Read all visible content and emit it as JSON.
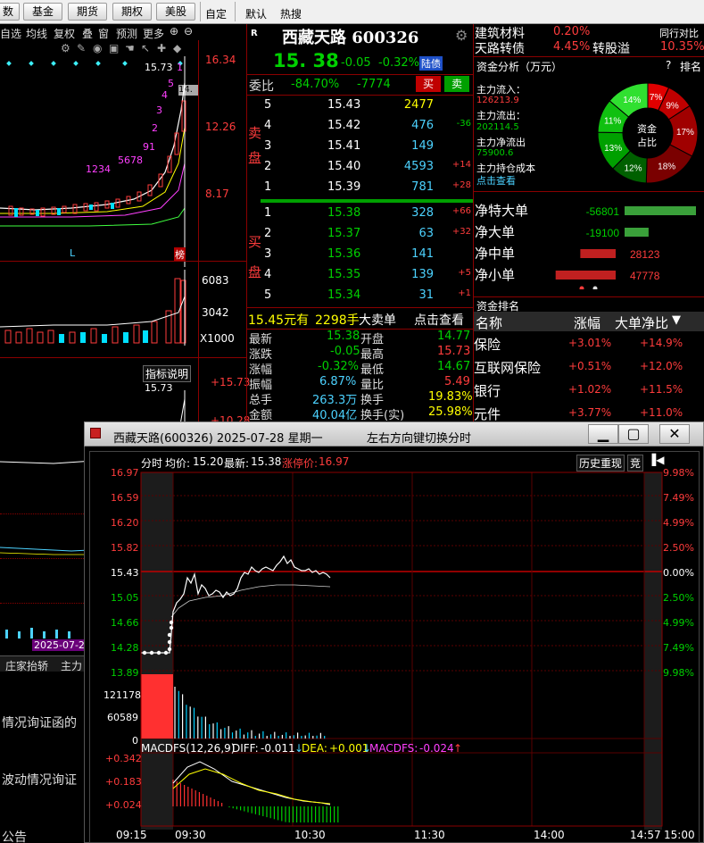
{
  "toolbar": {
    "buttons": [
      "数",
      "基金",
      "期货",
      "期权",
      "美股"
    ],
    "labels": [
      "自定",
      "默认",
      "热搜"
    ]
  },
  "left_panel": {
    "tabs": [
      "自选",
      "均线",
      "复权",
      "叠",
      "窗",
      "预测",
      "更多"
    ],
    "kline_prices": [
      "16.34",
      "12.26",
      "8.17"
    ],
    "kline_last": "15.73",
    "kline_cut": "14.",
    "seq_labels": [
      "1234",
      "5678",
      "91",
      "2",
      "3",
      "4",
      "5",
      "1"
    ],
    "l_marker": "L",
    "tag_bang": "榜",
    "vol_labels": [
      "6083",
      "3042",
      "X1000"
    ],
    "ind_title": "指标说明",
    "ind_last": "15.73",
    "ind_axis": [
      "+15.73",
      "+10.28"
    ],
    "date_tag": "2025-07-2",
    "bottom_tabs": [
      "庄家抬轿",
      "主力"
    ],
    "news": [
      "情况询证函的",
      "波动情况询证",
      "公告"
    ]
  },
  "stock": {
    "badge": "R",
    "name": "西藏天路 600326",
    "price": "15. 38",
    "change": "-0.05",
    "change_pct": "-0.32%",
    "tag": "陆债",
    "weibi_label": "委比",
    "weibi_pct": "-84.70%",
    "weibi_diff": "-7774",
    "buy_btn": "买",
    "sell_btn": "卖",
    "sell_label": [
      "卖",
      "盘"
    ],
    "buy_label": [
      "买",
      "盘"
    ],
    "asks": [
      {
        "lvl": "5",
        "price": "15.43",
        "vol": "2477",
        "chg": ""
      },
      {
        "lvl": "4",
        "price": "15.42",
        "vol": "476",
        "chg": "-36"
      },
      {
        "lvl": "3",
        "price": "15.41",
        "vol": "149",
        "chg": ""
      },
      {
        "lvl": "2",
        "price": "15.40",
        "vol": "4593",
        "chg": "+14"
      },
      {
        "lvl": "1",
        "price": "15.39",
        "vol": "781",
        "chg": "+28"
      }
    ],
    "bids": [
      {
        "lvl": "1",
        "price": "15.38",
        "vol": "328",
        "chg": "+66"
      },
      {
        "lvl": "2",
        "price": "15.37",
        "vol": "63",
        "chg": "+32"
      },
      {
        "lvl": "3",
        "price": "15.36",
        "vol": "141",
        "chg": ""
      },
      {
        "lvl": "4",
        "price": "15.35",
        "vol": "139",
        "chg": "+5"
      },
      {
        "lvl": "5",
        "price": "15.34",
        "vol": "31",
        "chg": "+1"
      }
    ],
    "big_order": {
      "price": "15.45元有",
      "vol": "2298手",
      "label": "大卖单",
      "link": "点击查看"
    },
    "stats": [
      {
        "l": "最新",
        "v": "15.38",
        "l2": "开盘",
        "v2": "14.77"
      },
      {
        "l": "涨跌",
        "v": "-0.05",
        "l2": "最高",
        "v2": "15.73"
      },
      {
        "l": "涨幅",
        "v": "-0.32%",
        "l2": "最低",
        "v2": "14.67"
      },
      {
        "l": "振幅",
        "v": "6.87%",
        "l2": "量比",
        "v2": "5.49"
      },
      {
        "l": "总手",
        "v": "263.3万",
        "l2": "换手",
        "v2": "19.83%"
      },
      {
        "l": "金额",
        "v": "40.04亿",
        "l2": "换手(实)",
        "v2": "25.98%"
      }
    ]
  },
  "right_panel": {
    "sector1": {
      "name": "建筑材料",
      "pct": "0.20%",
      "extra": "同行对比"
    },
    "sector2": {
      "name": "天路转债",
      "pct": "4.45%",
      "label": "转股溢",
      "val": "10.35%"
    },
    "fund_title": "资金分析（万元）",
    "fund_help": "?",
    "fund_rank": "排名",
    "flow_in_label": "主力流入：",
    "flow_in": "126213.9",
    "flow_out_label": "主力流出：",
    "flow_out": "202114.5",
    "net_label": "主力净流出",
    "net": "75900.6",
    "cost_label": "主力持仓成本",
    "cost_link": "点击查看",
    "donut_center": [
      "资金",
      "占比"
    ],
    "donut": [
      {
        "label": "7%",
        "value": 7,
        "color": "#e00000"
      },
      {
        "label": "9%",
        "value": 9,
        "color": "#c00000"
      },
      {
        "label": "17%",
        "value": 17,
        "color": "#a00000"
      },
      {
        "label": "18%",
        "value": 18,
        "color": "#7a0000"
      },
      {
        "label": "12%",
        "value": 12,
        "color": "#006000"
      },
      {
        "label": "13%",
        "value": 13,
        "color": "#00a000"
      },
      {
        "label": "11%",
        "value": 11,
        "color": "#10c010"
      },
      {
        "label": "14%",
        "value": 14,
        "color": "#30e030"
      }
    ],
    "net_flows": [
      {
        "label": "净特大单",
        "value": -56801,
        "text": "-56801"
      },
      {
        "label": "净大单",
        "value": -19100,
        "text": "-19100"
      },
      {
        "label": "净中单",
        "value": 28123,
        "text": "28123"
      },
      {
        "label": "净小单",
        "value": 47778,
        "text": "47778"
      }
    ],
    "rank_title": "资金排名",
    "rank_headers": [
      "名称",
      "涨幅",
      "大单净比"
    ],
    "rank_rows": [
      {
        "name": "保险",
        "pct": "+3.01%",
        "net": "+14.9%"
      },
      {
        "name": "互联网保险",
        "pct": "+0.51%",
        "net": "+12.0%"
      },
      {
        "name": "银行",
        "pct": "+1.02%",
        "net": "+11.5%"
      },
      {
        "name": "元件",
        "pct": "+3.77%",
        "net": "+11.0%"
      }
    ]
  },
  "popup": {
    "title": "西藏天路(600326) 2025-07-28 星期一",
    "hint": "左右方向键切换分时",
    "info": {
      "label": "分时",
      "avg_label": "均价:",
      "avg": "15.20",
      "last_label": "最新:",
      "last": "15.38",
      "limit_label": "涨停价:",
      "limit": "16.97"
    },
    "history_btn": "历史重现",
    "bid_btn": "竞",
    "left_axis": [
      "16.97",
      "16.59",
      "16.20",
      "15.82",
      "15.43",
      "15.05",
      "14.66",
      "14.28",
      "13.89"
    ],
    "right_axis": [
      "9.98%",
      "7.49%",
      "4.99%",
      "2.50%",
      "0.00%",
      "2.50%",
      "4.99%",
      "7.49%",
      "9.98%"
    ],
    "vol_axis": [
      "121178",
      "60589",
      "0"
    ],
    "macd_title": "MACDFS(12,26,9)",
    "diff_label": "DIFF:",
    "diff": "-0.011",
    "dea_label": "DEA:",
    "dea": "+0.001",
    "macdfs_label": "MACDFS:",
    "macdfs": "-0.024",
    "macd_axis": [
      "+0.342",
      "+0.183",
      "+0.024"
    ],
    "time_axis": [
      "09:15",
      "09:30",
      "10:30",
      "11:30",
      "14:00",
      "14:57",
      "15:00"
    ]
  }
}
